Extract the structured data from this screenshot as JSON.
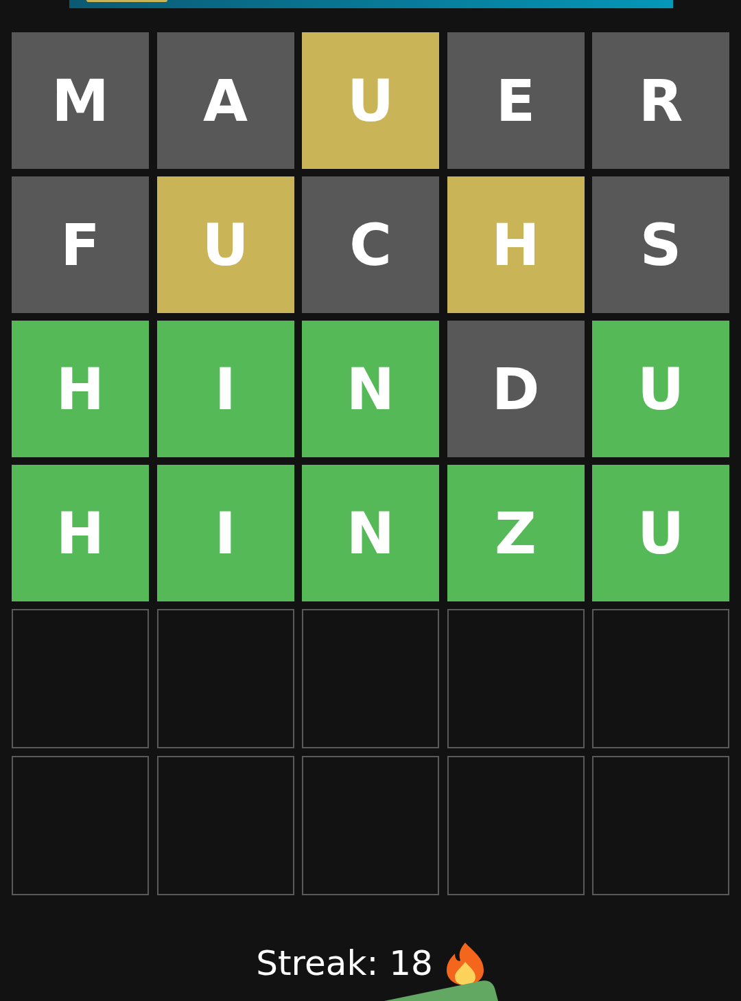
{
  "board": [
    [
      {
        "letter": "M",
        "kind": "absent"
      },
      {
        "letter": "A",
        "kind": "absent"
      },
      {
        "letter": "U",
        "kind": "present"
      },
      {
        "letter": "E",
        "kind": "absent"
      },
      {
        "letter": "R",
        "kind": "absent"
      }
    ],
    [
      {
        "letter": "F",
        "kind": "absent"
      },
      {
        "letter": "U",
        "kind": "present"
      },
      {
        "letter": "C",
        "kind": "absent"
      },
      {
        "letter": "H",
        "kind": "present"
      },
      {
        "letter": "S",
        "kind": "absent"
      }
    ],
    [
      {
        "letter": "H",
        "kind": "correct"
      },
      {
        "letter": "I",
        "kind": "correct"
      },
      {
        "letter": "N",
        "kind": "correct"
      },
      {
        "letter": "D",
        "kind": "absent"
      },
      {
        "letter": "U",
        "kind": "correct"
      }
    ],
    [
      {
        "letter": "H",
        "kind": "correct"
      },
      {
        "letter": "I",
        "kind": "correct"
      },
      {
        "letter": "N",
        "kind": "correct"
      },
      {
        "letter": "Z",
        "kind": "correct"
      },
      {
        "letter": "U",
        "kind": "correct"
      }
    ],
    [
      {
        "kind": "empty"
      },
      {
        "kind": "empty"
      },
      {
        "kind": "empty"
      },
      {
        "kind": "empty"
      },
      {
        "kind": "empty"
      }
    ],
    [
      {
        "kind": "empty"
      },
      {
        "kind": "empty"
      },
      {
        "kind": "empty"
      },
      {
        "kind": "empty"
      },
      {
        "kind": "empty"
      }
    ]
  ],
  "streak": {
    "label": "Streak: 18"
  }
}
